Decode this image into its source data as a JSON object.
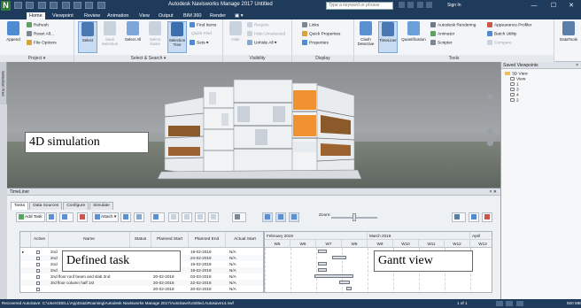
{
  "titlebar": {
    "logo": "N",
    "title": "Autodesk Navisworks Manage 2017   Untitled",
    "search_placeholder": "Type a keyword or phrase",
    "signin": "Sign In",
    "min": "—",
    "max": "☐",
    "close": "✕"
  },
  "ribbon_tabs": [
    "Home",
    "Viewpoint",
    "Review",
    "Animation",
    "View",
    "Output",
    "BIM 360",
    "Render",
    "▣ ▾"
  ],
  "ribbon": {
    "project": {
      "label": "Project ▾",
      "append": "Append",
      "refresh": "Refresh",
      "reset_all": "Reset All...",
      "file_options": "File Options"
    },
    "select_search": {
      "label": "Select & Search ▾",
      "select": "Select",
      "save_selection": "Save Selection",
      "select_all": "Select All",
      "select_same": "Select Same",
      "selection_tree": "Selection Tree",
      "find_items": "Find Items",
      "quick_find": "Quick Find",
      "sets": "Sets ▾"
    },
    "visibility": {
      "label": "Visibility",
      "hide": "Hide",
      "require": "Require",
      "hide_unselected": "Hide Unselected",
      "unhide_all": "Unhide All ▾"
    },
    "display": {
      "label": "Display",
      "links": "Links",
      "quick_properties": "Quick Properties",
      "properties": "Properties"
    },
    "tools": {
      "label": "Tools",
      "clash_detective": "Clash Detective",
      "timeliner": "TimeLiner",
      "quantification": "Quantification",
      "autodesk_rendering": "Autodesk Rendering",
      "animator": "Animator",
      "scripter": "Scripter",
      "appearance_profiler": "Appearance Profiler",
      "batch_utility": "Batch Utility",
      "compare": "Compare",
      "datatools": "DataTools"
    }
  },
  "left_vtab": "Selection Tree",
  "viewport": {
    "callout": "4D simulation"
  },
  "saved_viewpoints": {
    "title": "Saved Viewpoints",
    "close": "×",
    "items": [
      "3D View",
      "View",
      "1",
      "3",
      "4",
      "2"
    ]
  },
  "timeliner": {
    "title": "TimeLiner",
    "close": "× ✕",
    "tabs": [
      "Tasks",
      "Data Sources",
      "Configure",
      "Simulate"
    ],
    "toolbar": {
      "add_task": "Add Task",
      "attach": "Attach ▾",
      "zoom_label": "Zoom:"
    },
    "columns": [
      "Active",
      "Name",
      "Status",
      "Planned Start",
      "Planned End",
      "Actual Start"
    ],
    "rows": [
      {
        "name": "2nd",
        "start": "",
        "end": "19-02-2018",
        "actual": "N/A"
      },
      {
        "name": "2nd",
        "start": "",
        "end": "24-02-2018",
        "actual": "N/A"
      },
      {
        "name": "2nd",
        "start": "",
        "end": "19-02-2018",
        "actual": "N/A"
      },
      {
        "name": "2nd",
        "start": "",
        "end": "19-02-2018",
        "actual": "N/A"
      },
      {
        "name": "2nd floor roof beam and slab 2nd",
        "start": "20-02-2018",
        "end": "03-03-2018",
        "actual": "N/A"
      },
      {
        "name": "3rd floor column half 1st",
        "start": "20-02-2018",
        "end": "22-02-2018",
        "actual": "N/A"
      },
      {
        "name": "",
        "start": "20-02-2018",
        "end": "20-02-2018",
        "actual": "N/A"
      }
    ],
    "task_callout": "Defined task",
    "gantt": {
      "months": [
        "February 2018",
        "March 2018",
        "April"
      ],
      "weeks": [
        "W5",
        "W6",
        "W7",
        "W8",
        "W9",
        "W10",
        "W11",
        "W12",
        "W13"
      ],
      "callout": "Gantt view"
    }
  },
  "statusbar": {
    "text": "Recovered AutoSave: C:\\Users\\DELL\\AppData\\Roaming\\Autodesk Navisworks Manage 2017\\AutoSave\\Untitled.Autosave14.nwf",
    "page": "1 of 1",
    "mem": "920 MB"
  }
}
